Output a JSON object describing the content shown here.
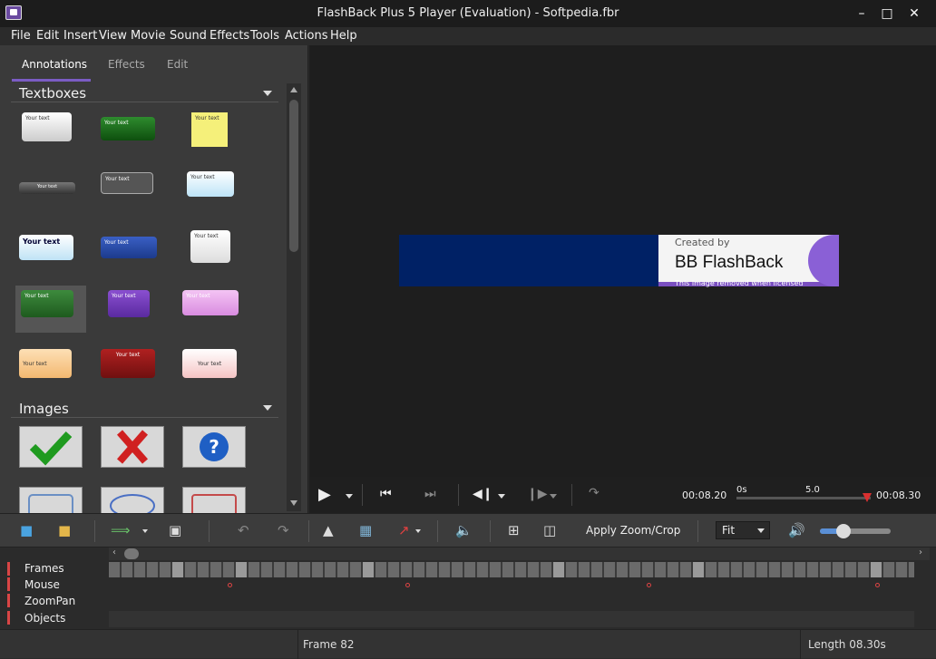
{
  "window": {
    "title": "FlashBack Plus 5 Player (Evaluation) - Softpedia.fbr"
  },
  "menu": [
    "File",
    "Edit",
    "Insert",
    "View",
    "Movie",
    "Sound",
    "Effects",
    "Tools",
    "Actions",
    "Help"
  ],
  "left_panel": {
    "tabs": [
      "Annotations",
      "Effects",
      "Edit"
    ],
    "sections": [
      "Textboxes",
      "Images"
    ],
    "textbox_sample": "Your text"
  },
  "viewer": {
    "banner": {
      "created_by": "Created by",
      "brand": "BB FlashBack",
      "watermark": "This image removed when licensed"
    }
  },
  "playback": {
    "current_time": "00:08.20",
    "end_time": "00:08.30",
    "ruler_start": "0s",
    "ruler_mid": "5.0"
  },
  "toolbar": {
    "apply_zoom_crop": "Apply Zoom/Crop",
    "zoom_select": "Fit"
  },
  "timeline": {
    "tracks": [
      "Frames",
      "Mouse",
      "ZoomPan",
      "Objects"
    ]
  },
  "status": {
    "frame": "Frame 82",
    "length": "Length 08.30s"
  }
}
